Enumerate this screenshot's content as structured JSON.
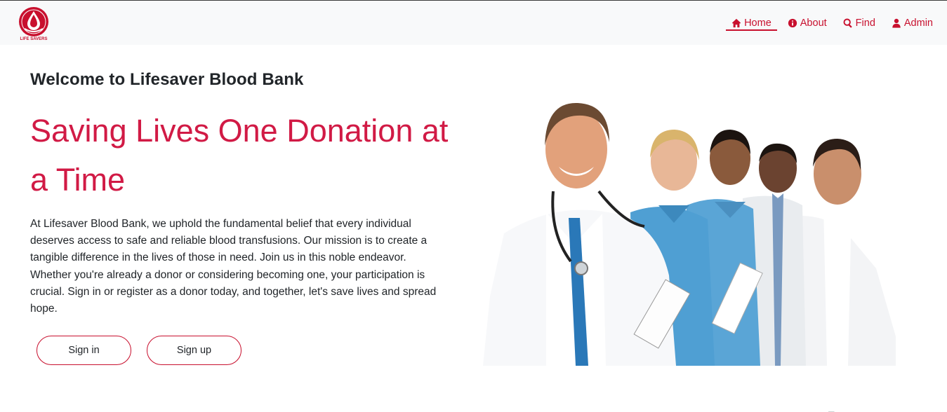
{
  "brand": {
    "logo_text": "LIFE SAVERS",
    "logo_mark": "A+ O- B+",
    "color": "#c8102e"
  },
  "nav": {
    "items": [
      {
        "label": "Home",
        "icon": "home-icon",
        "active": true
      },
      {
        "label": "About",
        "icon": "info-icon",
        "active": false
      },
      {
        "label": "Find",
        "icon": "search-icon",
        "active": false
      },
      {
        "label": "Admin",
        "icon": "user-icon",
        "active": false
      }
    ]
  },
  "hero": {
    "welcome": "Welcome to Lifesaver Blood Bank",
    "headline": "Saving Lives One Donation at a Time",
    "paragraph": "At Lifesaver Blood Bank, we uphold the fundamental belief that every individual deserves access to safe and reliable blood transfusions. Our mission is to create a tangible difference in the lives of those in need. Join us in this noble endeavor. Whether you're already a donor or considering becoming one, your participation is crucial. Sign in or register as a donor today, and together, let's save lives and spread hope.",
    "signin_label": "Sign in",
    "signup_label": "Sign up"
  },
  "colors": {
    "accent": "#c8102e",
    "headline": "#d11a45",
    "navbar_bg": "#f8f9fa"
  }
}
